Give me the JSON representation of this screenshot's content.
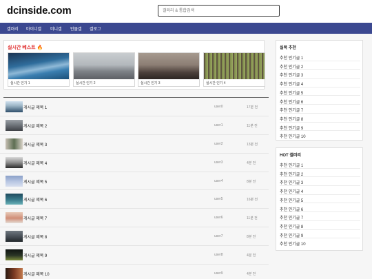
{
  "header": {
    "logo": "dcinside.com",
    "search_placeholder": "갤러리 & 통합검색"
  },
  "nav": {
    "items": [
      "갤러리",
      "마이너갤",
      "미니갤",
      "인물갤",
      "갤로그"
    ]
  },
  "best": {
    "title": "실시간 베스트 🔥",
    "cards": [
      {
        "label": "실시간 인기 1"
      },
      {
        "label": "실시간 인기 2"
      },
      {
        "label": "실시간 인기 3"
      },
      {
        "label": "실시간 인기 4"
      }
    ]
  },
  "posts": [
    {
      "title": "게시글 제목 1",
      "user": "user0",
      "time": "17분 전"
    },
    {
      "title": "게시글 제목 2",
      "user": "user1",
      "time": "11분 전"
    },
    {
      "title": "게시글 제목 3",
      "user": "user2",
      "time": "13분 전"
    },
    {
      "title": "게시글 제목 4",
      "user": "user3",
      "time": "4분 전"
    },
    {
      "title": "게시글 제목 5",
      "user": "user4",
      "time": "8분 전"
    },
    {
      "title": "게시글 제목 6",
      "user": "user5",
      "time": "16분 전"
    },
    {
      "title": "게시글 제목 7",
      "user": "user6",
      "time": "11분 전"
    },
    {
      "title": "게시글 제목 8",
      "user": "user7",
      "time": "8분 전"
    },
    {
      "title": "게시글 제목 9",
      "user": "user8",
      "time": "4분 전"
    },
    {
      "title": "게시글 제목 10",
      "user": "user9",
      "time": "4분 전"
    }
  ],
  "sidebar": {
    "recommend": {
      "title": "실북 추천",
      "items": [
        "추천 인기글 1",
        "추천 인기글 2",
        "추천 인기글 3",
        "추천 인기글 4",
        "추천 인기글 5",
        "추천 인기글 6",
        "추천 인기글 7",
        "추천 인기글 8",
        "추천 인기글 9",
        "추천 인기글 10"
      ]
    },
    "hot": {
      "title": "HOT 갤러리",
      "items": [
        "추천 인기글 1",
        "추천 인기글 2",
        "추천 인기글 3",
        "추천 인기글 4",
        "추천 인기글 5",
        "추천 인기글 6",
        "추천 인기글 7",
        "추천 인기글 8",
        "추천 인기글 9",
        "추천 인기글 10"
      ]
    }
  },
  "colors": {
    "nav_bg": "#3b4890",
    "best_title": "#e03131",
    "page_bg": "#f6f6f6"
  }
}
